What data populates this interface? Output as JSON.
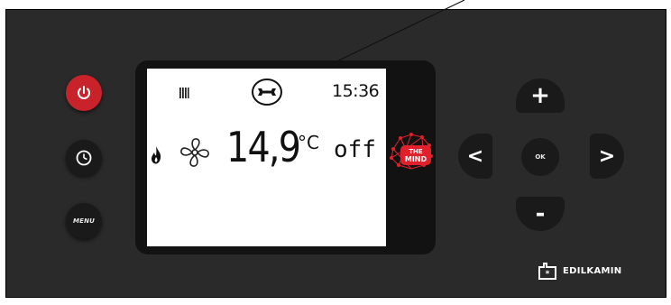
{
  "display": {
    "clock": "15:36",
    "temperature": "14,9",
    "unit": "°C",
    "state": "off",
    "mind_logo": {
      "line1": "THE",
      "line2": "MIND"
    }
  },
  "buttons": {
    "menu_label": "MENU",
    "ok_label": "OK",
    "plus_label": "+",
    "minus_label": "-",
    "left_label": "<",
    "right_label": ">"
  },
  "brand": {
    "name": "EDILKAMIN"
  },
  "icons": {
    "power": "power-icon",
    "clock": "clock-icon",
    "stove": "stove-icon",
    "wrench": "wrench-icon",
    "flame": "flame-icon",
    "fan": "fan-icon",
    "logo": "edilkamin-logo-icon"
  },
  "colors": {
    "panel": "#2a2a2a",
    "power_button": "#c8232b",
    "mind_logo": "#e0202a",
    "screen": "#ffffff"
  }
}
